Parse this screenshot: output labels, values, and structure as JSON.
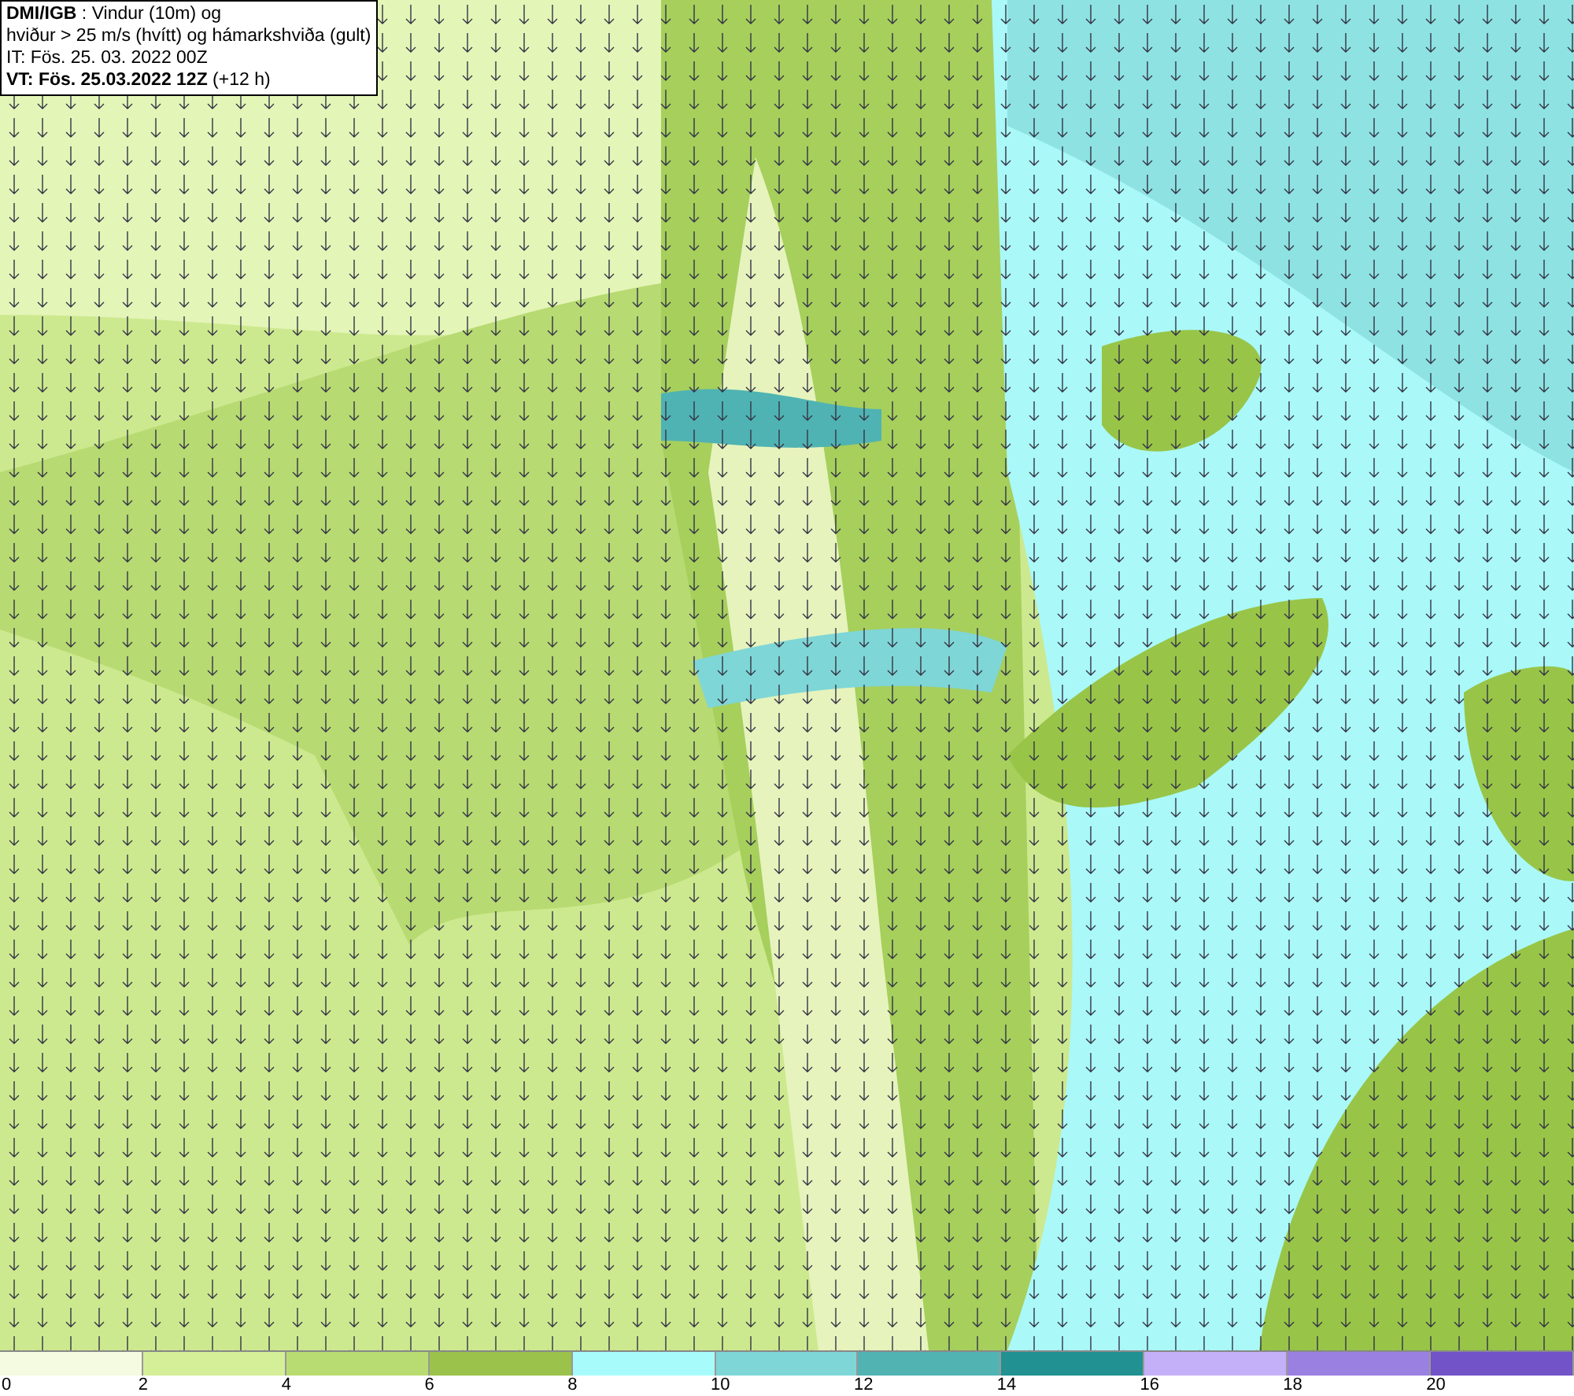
{
  "header": {
    "lines": [
      "**DMI/IGB** : Vindur (10m) og",
      "hviður > 25 m/s (hvítt) og hámarkshviða (gult)",
      "IT: Fös. 25. 03. 2022 00Z",
      "**VT: Fös. 25.03.2022 12Z** (+12 h)"
    ]
  },
  "legend": {
    "segments": [
      {
        "label": "0",
        "color": "#f4fbe0"
      },
      {
        "label": "2",
        "color": "#d5ee98"
      },
      {
        "label": "4",
        "color": "#b9dc72"
      },
      {
        "label": "6",
        "color": "#9bc24a"
      },
      {
        "label": "8",
        "color": "#a8fbfb"
      },
      {
        "label": "10",
        "color": "#7fd6d6"
      },
      {
        "label": "12",
        "color": "#52b3b3"
      },
      {
        "label": "14",
        "color": "#219191"
      },
      {
        "label": "16",
        "color": "#c4b0f8"
      },
      {
        "label": "18",
        "color": "#9a80e0"
      },
      {
        "label": "20",
        "color": "#7253c8"
      }
    ]
  }
}
